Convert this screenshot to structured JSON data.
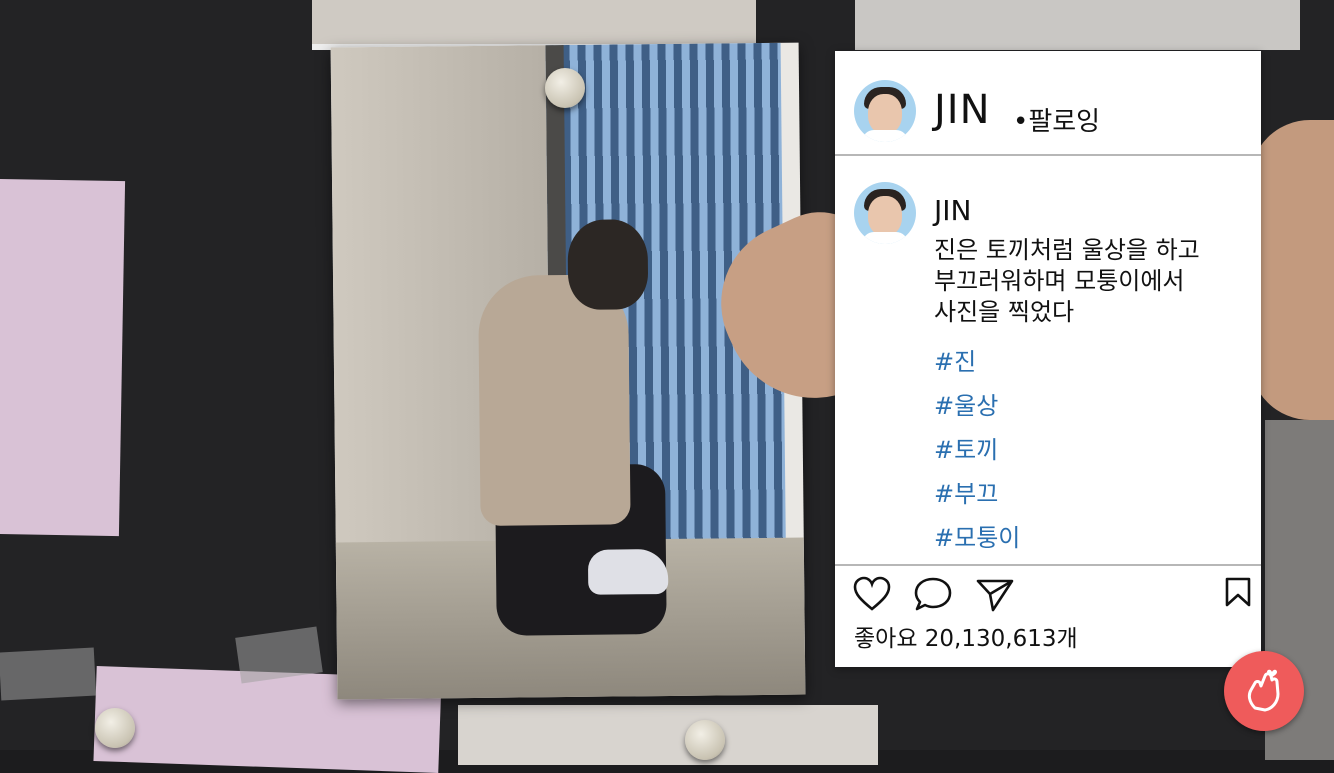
{
  "profile": {
    "username": "JIN",
    "follow_label": "•팔로잉"
  },
  "post": {
    "username": "JIN",
    "caption": "진은 토끼처럼 울상을 하고\n부끄러워하며 모퉁이에서\n사진을 찍었다",
    "hashtags": [
      "#진",
      "#울상",
      "#토끼",
      "#부끄",
      "#모퉁이"
    ]
  },
  "actions": {
    "like_icon": "heart-icon",
    "comment_icon": "comment-icon",
    "share_icon": "send-icon",
    "save_icon": "bookmark-icon"
  },
  "likes": {
    "text": "좋아요 20,130,613개"
  },
  "colors": {
    "hashtag": "#2a6fb0",
    "fab": "#ef5b5b",
    "avatar_bg": "#a8d3ef"
  },
  "fab_icon": "finger-heart-icon"
}
